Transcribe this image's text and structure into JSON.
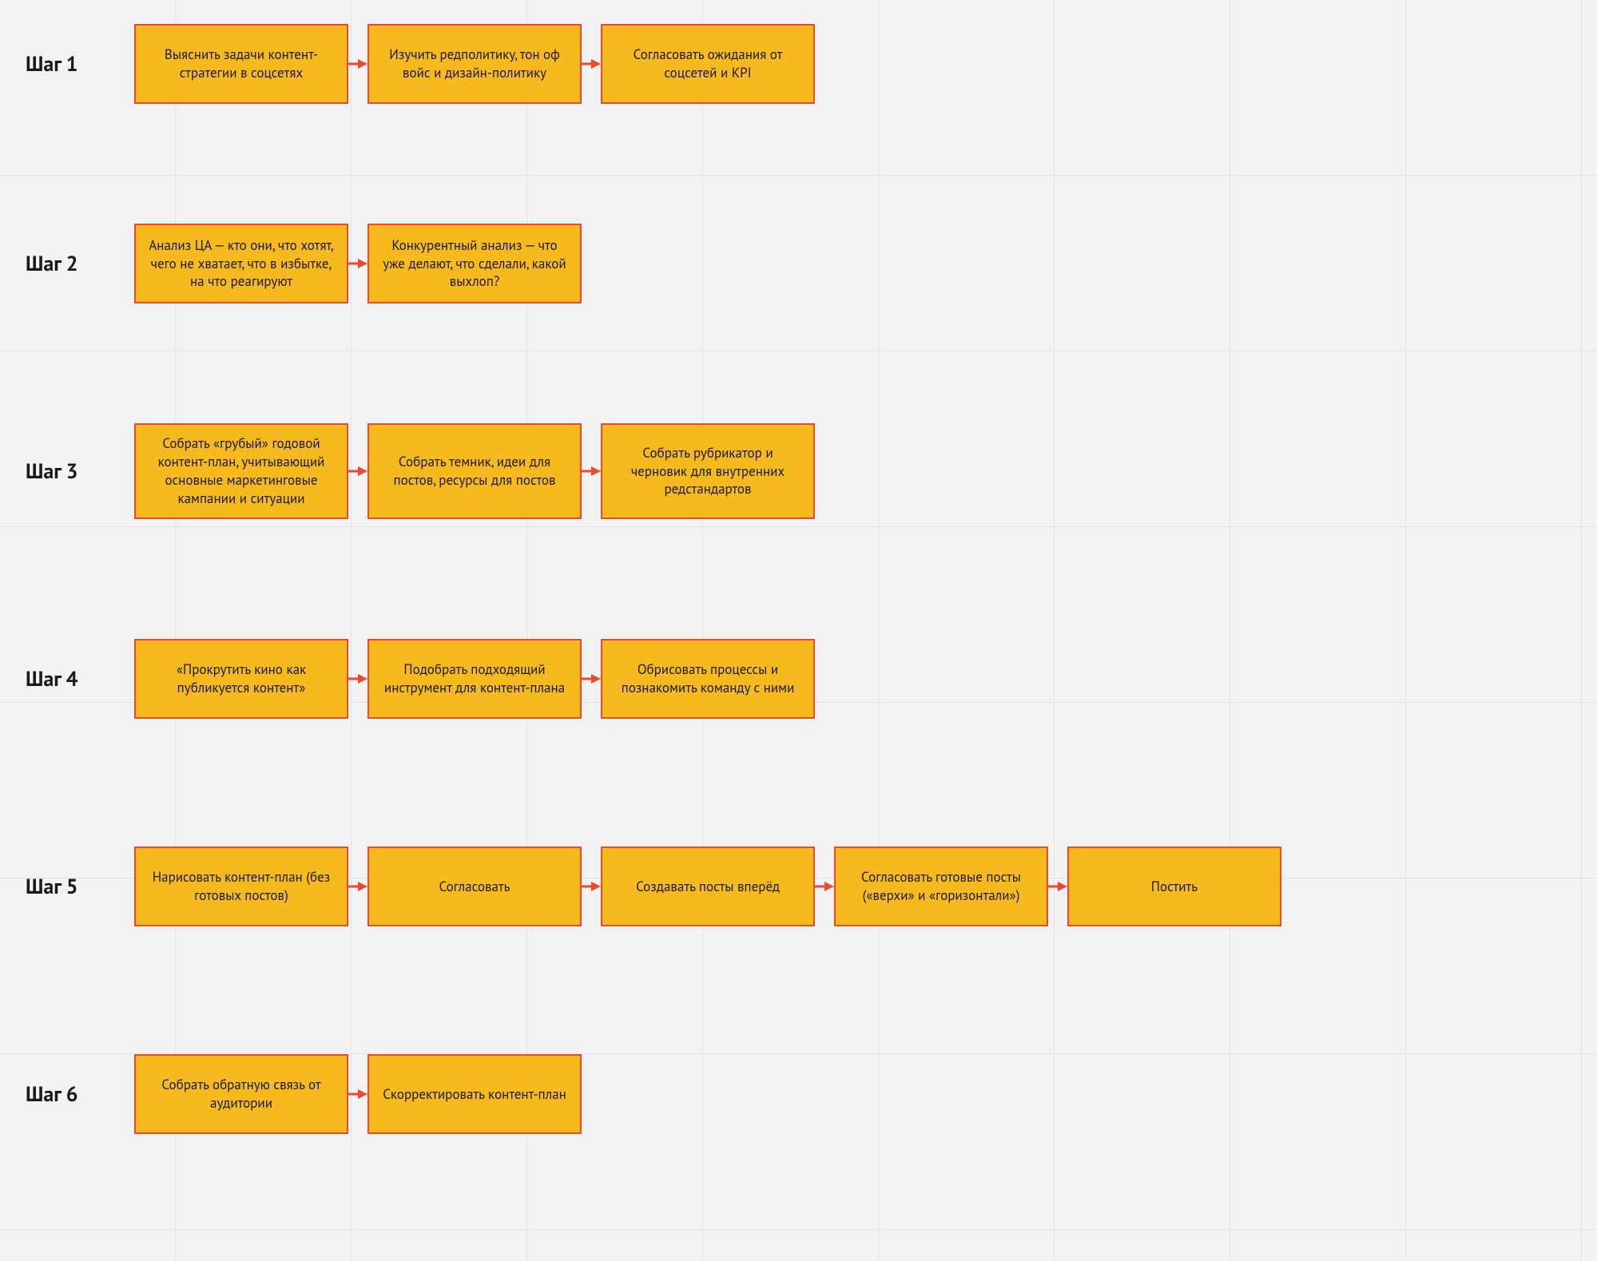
{
  "colors": {
    "node_fill": "#f6b91e",
    "node_border": "#ea4a30",
    "arrow": "#ea4a30",
    "background": "#f2f2f2",
    "grid_line": "#e4e4e4"
  },
  "rows": [
    {
      "label": "Шаг 1",
      "nodes": [
        "Выяснить задачи контент-стратегии в соцсетях",
        "Изучить редполитику, тон оф войс и дизайн-политику",
        "Согласовать ожидания от соцсетей и KPI"
      ]
    },
    {
      "label": "Шаг 2",
      "nodes": [
        "Анализ ЦА — кто они, что хотят, чего не хватает, что в избытке, на что реагируют",
        "Конкурентный анализ — что уже делают, что сделали, какой выхлоп?"
      ]
    },
    {
      "label": "Шаг 3",
      "nodes": [
        "Собрать «грубый» годовой контент-план, учитывающий основные маркетинговые кампании и ситуации",
        "Собрать темник, идеи для постов, ресурсы для постов",
        "Собрать рубрикатор и черновик для внутренних редстандартов"
      ]
    },
    {
      "label": "Шаг 4",
      "nodes": [
        "«Прокрутить кино как публикуется контент»",
        "Подобрать подходящий инструмент для контент-плана",
        "Обрисовать процессы и познакомить команду с ними"
      ]
    },
    {
      "label": "Шаг 5",
      "nodes": [
        "Нарисовать контент-план (без готовых постов)",
        "Согласовать",
        "Создавать посты вперёд",
        "Согласовать готовые посты («верхи» и «горизонтали»)",
        "Постить"
      ]
    },
    {
      "label": "Шаг 6",
      "nodes": [
        "Собрать обратную связь от аудитории",
        "Скорректировать контент-план"
      ]
    }
  ]
}
